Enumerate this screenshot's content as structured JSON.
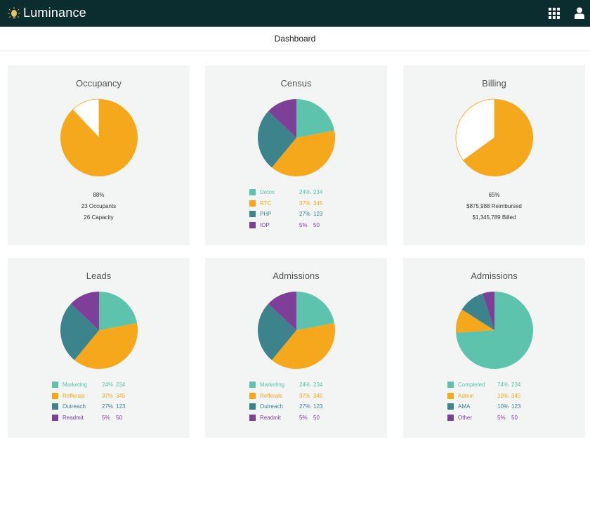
{
  "app": {
    "brand": "Luminance",
    "logo_icon": "lightbulb-icon",
    "apps_icon": "grid-icon",
    "user_icon": "user-icon"
  },
  "header": {
    "title": "Dashboard"
  },
  "colors": {
    "teal": "#5ec3ad",
    "orange": "#f5a81c",
    "dark_teal": "#3d838c",
    "purple": "#7e3f98",
    "empty": "#ffffff"
  },
  "cards": [
    {
      "title": "Occupancy",
      "stats": {
        "line1": "88%",
        "line2": "23 Occupants",
        "line3": "26 Capacity"
      },
      "slices": [
        {
          "value": 0.88,
          "color": "#f5a81c"
        },
        {
          "value": 0.12,
          "color": "#ffffff"
        }
      ]
    },
    {
      "title": "Census",
      "legend": [
        {
          "label": "Detox",
          "pct": "24%",
          "count": "234",
          "color": "#5ec3ad"
        },
        {
          "label": "RTC",
          "pct": "37%",
          "count": "345",
          "color": "#f5a81c"
        },
        {
          "label": "PHP",
          "pct": "27%",
          "count": "123",
          "color": "#3d838c"
        },
        {
          "label": "IOP",
          "pct": "5%",
          "count": "50",
          "color": "#7e3f98"
        }
      ],
      "slices": [
        {
          "value": 0.22,
          "color": "#5ec3ad"
        },
        {
          "value": 0.39,
          "color": "#f5a81c"
        },
        {
          "value": 0.26,
          "color": "#3d838c"
        },
        {
          "value": 0.13,
          "color": "#7e3f98"
        }
      ]
    },
    {
      "title": "Billing",
      "stats": {
        "line1": "65%",
        "line2": "$875,988 Reimbursed",
        "line3": "$1,345,789 Billed"
      },
      "slices": [
        {
          "value": 0.65,
          "color": "#f5a81c"
        },
        {
          "value": 0.35,
          "color": "#ffffff"
        }
      ]
    },
    {
      "title": "Leads",
      "legend": [
        {
          "label": "Marketing",
          "pct": "24%",
          "count": "234",
          "color": "#5ec3ad"
        },
        {
          "label": "Refferals",
          "pct": "37%",
          "count": "345",
          "color": "#f5a81c"
        },
        {
          "label": "Outreach",
          "pct": "27%",
          "count": "123",
          "color": "#3d838c"
        },
        {
          "label": "Readmit",
          "pct": "5%",
          "count": "50",
          "color": "#7e3f98"
        }
      ],
      "slices": [
        {
          "value": 0.22,
          "color": "#5ec3ad"
        },
        {
          "value": 0.39,
          "color": "#f5a81c"
        },
        {
          "value": 0.26,
          "color": "#3d838c"
        },
        {
          "value": 0.13,
          "color": "#7e3f98"
        }
      ]
    },
    {
      "title": "Admissions",
      "legend": [
        {
          "label": "Marketing",
          "pct": "24%",
          "count": "234",
          "color": "#5ec3ad"
        },
        {
          "label": "Refferals",
          "pct": "37%",
          "count": "345",
          "color": "#f5a81c"
        },
        {
          "label": "Outreach",
          "pct": "27%",
          "count": "123",
          "color": "#3d838c"
        },
        {
          "label": "Readmit",
          "pct": "5%",
          "count": "50",
          "color": "#7e3f98"
        }
      ],
      "slices": [
        {
          "value": 0.22,
          "color": "#5ec3ad"
        },
        {
          "value": 0.39,
          "color": "#f5a81c"
        },
        {
          "value": 0.26,
          "color": "#3d838c"
        },
        {
          "value": 0.13,
          "color": "#7e3f98"
        }
      ]
    },
    {
      "title": "Admissions",
      "legend": [
        {
          "label": "Completed",
          "pct": "74%",
          "count": "234",
          "color": "#5ec3ad"
        },
        {
          "label": "Admin",
          "pct": "10%",
          "count": "345",
          "color": "#f5a81c"
        },
        {
          "label": "AMA",
          "pct": "10%",
          "count": "123",
          "color": "#3d838c"
        },
        {
          "label": "Other",
          "pct": "5%",
          "count": "50",
          "color": "#7e3f98"
        }
      ],
      "slices": [
        {
          "value": 0.74,
          "color": "#5ec3ad"
        },
        {
          "value": 0.1,
          "color": "#f5a81c"
        },
        {
          "value": 0.11,
          "color": "#3d838c"
        },
        {
          "value": 0.05,
          "color": "#7e3f98"
        }
      ]
    }
  ]
}
